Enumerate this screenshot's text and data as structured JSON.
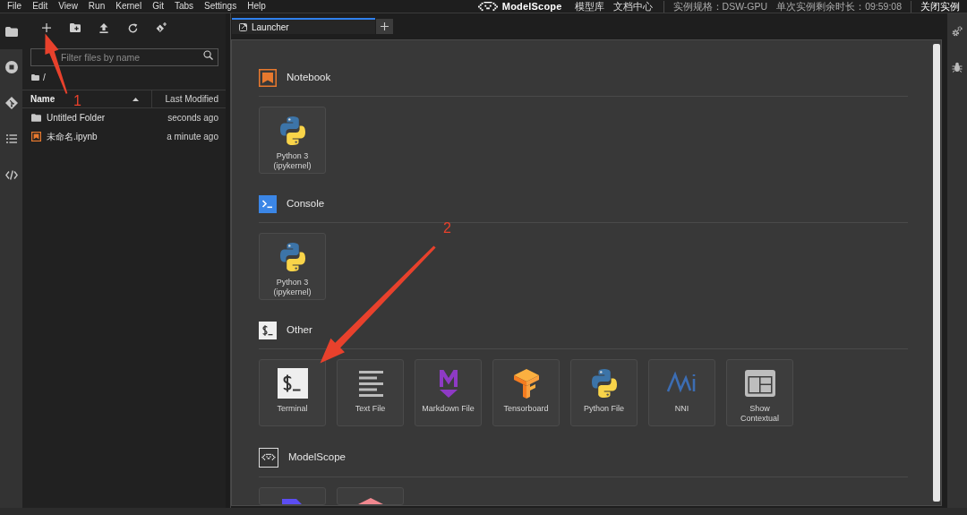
{
  "menu_bar": {
    "menus": [
      "File",
      "Edit",
      "View",
      "Run",
      "Kernel",
      "Git",
      "Tabs",
      "Settings",
      "Help"
    ],
    "brand": "ModelScope",
    "links": [
      "模型库",
      "文档中心"
    ],
    "instance_spec": "实例规格：DSW-GPU",
    "remaining_time": "单次实例剩余时长：09:59:08",
    "close_button": "关闭实例"
  },
  "activity_bar": [
    {
      "selected": true
    },
    {
      "selected": false
    },
    {
      "selected": false
    },
    {
      "selected": false
    },
    {
      "selected": false
    }
  ],
  "file_browser": {
    "filter": {
      "placeholder": "Filter files by name"
    },
    "breadcrumb": "/",
    "columns": [
      {
        "label": "Name",
        "sorted": true
      },
      {
        "label": "Last Modified",
        "sorted": false
      }
    ],
    "rows": [
      {
        "kind": "folder",
        "name": "Untitled Folder",
        "modified": "seconds ago"
      },
      {
        "kind": "notebook",
        "name": "未命名.ipynb",
        "modified": "a minute ago"
      }
    ]
  },
  "tabs": [
    {
      "label": "Launcher",
      "selected": true
    }
  ],
  "launcher": {
    "sections": [
      {
        "kind": "notebook",
        "title": "Notebook",
        "cards": [
          {
            "kind": "python",
            "label": "Python 3 (ipykernel)"
          }
        ]
      },
      {
        "kind": "console",
        "title": "Console",
        "cards": [
          {
            "kind": "python",
            "label": "Python 3 (ipykernel)"
          }
        ]
      },
      {
        "kind": "other",
        "title": "Other",
        "cards": [
          {
            "kind": "terminal",
            "label": "Terminal"
          },
          {
            "kind": "text",
            "label": "Text File"
          },
          {
            "kind": "markdown",
            "label": "Markdown File"
          },
          {
            "kind": "tensorboard",
            "label": "Tensorboard"
          },
          {
            "kind": "python",
            "label": "Python File"
          },
          {
            "kind": "nni",
            "label": "NNI"
          },
          {
            "kind": "layout",
            "label": "Show Contextual"
          }
        ]
      },
      {
        "kind": "modelscope",
        "title": "ModelScope",
        "cards": [
          {
            "kind": "block"
          },
          {
            "kind": "cube"
          }
        ]
      }
    ]
  },
  "annotations": [
    {
      "label": "1"
    },
    {
      "label": "2"
    }
  ]
}
